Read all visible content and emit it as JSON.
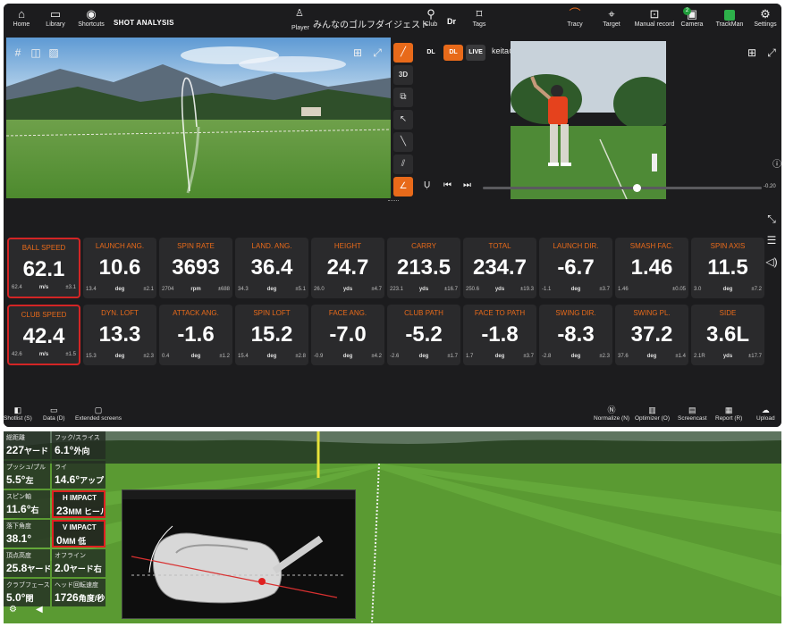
{
  "toolbar": {
    "home": "Home",
    "library": "Library",
    "shortcuts": "Shortcuts",
    "title": "SHOT ANALYSIS",
    "player_label": "Player",
    "player_name": "みんなのゴルフダイジェスト",
    "club_label": "Club",
    "club_value": "Dr",
    "tags": "Tags",
    "tracy": "Tracy",
    "target": "Target",
    "manual_record": "Manual record",
    "camera": "Camera",
    "camera_badge": "2",
    "trackman": "TrackMan",
    "settings": "Settings"
  },
  "video": {
    "tools": [
      "3D"
    ],
    "mode_dl1": "DL",
    "mode_dl2": "DL",
    "mode_live": "LIVE",
    "device": "keitaのiPhone",
    "scrub_value": "-0.20",
    "scrub_progress": 0.55
  },
  "metrics": [
    {
      "label": "BALL SPEED",
      "value": "62.1",
      "a": "62.4",
      "unit": "m/s",
      "b": "±3.1",
      "highlight": true
    },
    {
      "label": "LAUNCH ANG.",
      "value": "10.6",
      "a": "13.4",
      "unit": "deg",
      "b": "±2.1",
      "highlight": false
    },
    {
      "label": "SPIN RATE",
      "value": "3693",
      "a": "2704",
      "unit": "rpm",
      "b": "±688",
      "highlight": false
    },
    {
      "label": "LAND. ANG.",
      "value": "36.4",
      "a": "34.3",
      "unit": "deg",
      "b": "±5.1",
      "highlight": false
    },
    {
      "label": "HEIGHT",
      "value": "24.7",
      "a": "26.0",
      "unit": "yds",
      "b": "±4.7",
      "highlight": false
    },
    {
      "label": "CARRY",
      "value": "213.5",
      "a": "223.1",
      "unit": "yds",
      "b": "±16.7",
      "highlight": false
    },
    {
      "label": "TOTAL",
      "value": "234.7",
      "a": "250.6",
      "unit": "yds",
      "b": "±19.3",
      "highlight": false
    },
    {
      "label": "LAUNCH DIR.",
      "value": "-6.7",
      "a": "-1.1",
      "unit": "deg",
      "b": "±3.7",
      "highlight": false
    },
    {
      "label": "SMASH FAC.",
      "value": "1.46",
      "a": "1.46",
      "unit": "",
      "b": "±0.05",
      "highlight": false
    },
    {
      "label": "SPIN AXIS",
      "value": "11.5",
      "a": "3.0",
      "unit": "deg",
      "b": "±7.2",
      "highlight": false
    },
    {
      "label": "CLUB SPEED",
      "value": "42.4",
      "a": "42.6",
      "unit": "m/s",
      "b": "±1.5",
      "highlight": true
    },
    {
      "label": "DYN. LOFT",
      "value": "13.3",
      "a": "15.3",
      "unit": "deg",
      "b": "±2.3",
      "highlight": false
    },
    {
      "label": "ATTACK ANG.",
      "value": "-1.6",
      "a": "0.4",
      "unit": "deg",
      "b": "±1.2",
      "highlight": false
    },
    {
      "label": "SPIN LOFT",
      "value": "15.2",
      "a": "15.4",
      "unit": "deg",
      "b": "±2.8",
      "highlight": false
    },
    {
      "label": "FACE ANG.",
      "value": "-7.0",
      "a": "-0.9",
      "unit": "deg",
      "b": "±4.2",
      "highlight": false
    },
    {
      "label": "CLUB PATH",
      "value": "-5.2",
      "a": "-2.6",
      "unit": "deg",
      "b": "±1.7",
      "highlight": false
    },
    {
      "label": "FACE TO PATH",
      "value": "-1.8",
      "a": "1.7",
      "unit": "deg",
      "b": "±3.7",
      "highlight": false
    },
    {
      "label": "SWING DIR.",
      "value": "-8.3",
      "a": "-2.8",
      "unit": "deg",
      "b": "±2.3",
      "highlight": false
    },
    {
      "label": "SWING PL.",
      "value": "37.2",
      "a": "37.6",
      "unit": "deg",
      "b": "±1.4",
      "highlight": false
    },
    {
      "label": "SIDE",
      "value": "3.6L",
      "a": "2.1R",
      "unit": "yds",
      "b": "±17.7",
      "highlight": false
    }
  ],
  "bottombar": {
    "shotlist": "Shotlist (S)",
    "data": "Data (D)",
    "extended": "Extended screens",
    "normalize": "Normalize (N)",
    "optimizer": "Optimizer (O)",
    "screencast": "Screencast",
    "report": "Report (R)",
    "upload": "Upload"
  },
  "sim": {
    "stats": [
      {
        "label": "総距離",
        "value": "227",
        "unit": "ヤード",
        "label2": "フック/スライス",
        "value2": "6.1°",
        "unit2": "外向"
      },
      {
        "label": "プッシュ/プル",
        "value": "5.5°",
        "unit": "左",
        "label2": "ライ",
        "value2": "14.6°",
        "unit2": "アップ"
      },
      {
        "label": "スピン軸",
        "value": "11.6°",
        "unit": "右",
        "label2": "H IMPACT",
        "value2": "23",
        "unit2": "MM ヒール"
      },
      {
        "label": "落下角度",
        "value": "38.1°",
        "unit": "",
        "label2": "V IMPACT",
        "value2": "0",
        "unit2": "MM 低"
      },
      {
        "label": "頂点高度",
        "value": "25.8",
        "unit": "ヤード",
        "label2": "オフライン",
        "value2": "2.0",
        "unit2": "ヤード右"
      },
      {
        "label": "クラブフェースイス",
        "value": "5.0°",
        "unit": "閉",
        "label2": "ヘッド回転速度",
        "value2": "1726",
        "unit2": "角度/秒"
      }
    ]
  },
  "colors": {
    "accent": "#e86a1a",
    "highlight": "#d32525",
    "panel": "#1c1c1e",
    "card": "#2a2a2c"
  }
}
